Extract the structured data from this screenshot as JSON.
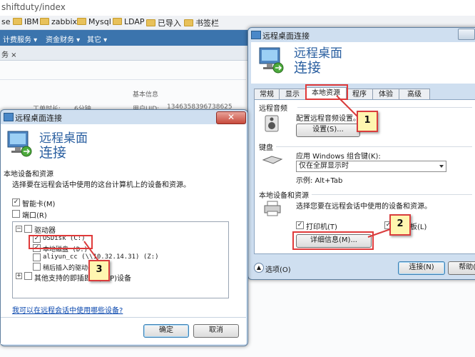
{
  "browser": {
    "url": "shiftduty/index",
    "bookmarks": [
      "se",
      "IBM",
      "zabbix",
      "Mysql",
      "LDAP",
      "已导入",
      "书签栏"
    ],
    "nav": [
      "计费服务 ▾",
      "资金财务 ▾",
      "其它 ▾"
    ],
    "tab": "务 ×",
    "bg": {
      "work_hours_label": "工单时长:",
      "work_hours_value": "6分钟",
      "basic_info": "基本信息",
      "uid_label": "用户UID:",
      "uid_value": "1346358396738625"
    }
  },
  "main_dialog": {
    "title": "远程桌面连接",
    "big_title_1": "远程桌面",
    "big_title_2": "连接",
    "tabs": [
      "常规",
      "显示",
      "本地资源",
      "程序",
      "体验",
      "高级"
    ],
    "active_tab": "本地资源",
    "audio": {
      "header": "远程音频",
      "desc": "配置远程音频设置。",
      "button": "设置(S)..."
    },
    "keyboard": {
      "header": "键盘",
      "desc": "应用 Windows 组合键(K):",
      "select": "仅在全屏显示时",
      "example": "示例: Alt+Tab"
    },
    "local": {
      "header": "本地设备和资源",
      "desc": "选择您要在远程会话中使用的设备和资源。",
      "printer": "打印机(T)",
      "clipboard": "板(L)",
      "details_button": "详细信息(M)..."
    },
    "options": "选项(O)",
    "connect": "连接(N)",
    "help": "帮助(H"
  },
  "sub_dialog": {
    "title": "远程桌面连接",
    "big_title_1": "远程桌面",
    "big_title_2": "连接",
    "section": "本地设备和资源",
    "desc": "选择要在远程会话中使用的这台计算机上的设备和资源。",
    "smartcard": "智能卡(M)",
    "ports": "端口(R)",
    "drives": "驱动器",
    "drive_items": [
      "OSDisk (C:)",
      "本地磁盘 (D:)",
      "aliyun_cc (\\\\10.32.14.31) (Z:)",
      "稍后插入的驱动器"
    ],
    "other": "其他支持的即插即用(PnP)设备",
    "link": "我可以在远程会话中使用哪些设备?",
    "ok": "确定",
    "cancel": "取消"
  },
  "callouts": [
    "1",
    "2",
    "3"
  ]
}
